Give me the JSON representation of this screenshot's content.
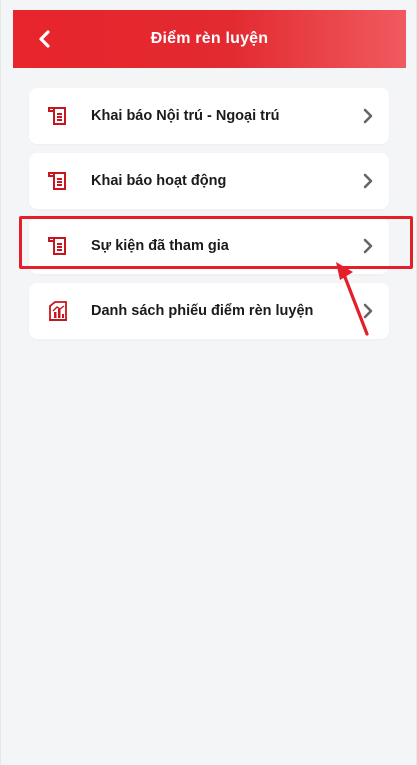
{
  "header": {
    "title": "Điểm rèn luyện",
    "back_icon": "chevron-left-icon"
  },
  "menu": {
    "items": [
      {
        "label": "Khai báo Nội trú - Ngoại trú",
        "icon": "document-list-icon"
      },
      {
        "label": "Khai báo hoạt động",
        "icon": "document-list-icon"
      },
      {
        "label": "Sự kiện đã tham gia",
        "icon": "document-list-icon"
      },
      {
        "label": "Danh sách phiếu điểm rèn luyện",
        "icon": "report-chart-icon"
      }
    ]
  },
  "colors": {
    "header_red": "#e8242c",
    "icon_red": "#c8161e",
    "highlight_red": "#e3202a"
  }
}
